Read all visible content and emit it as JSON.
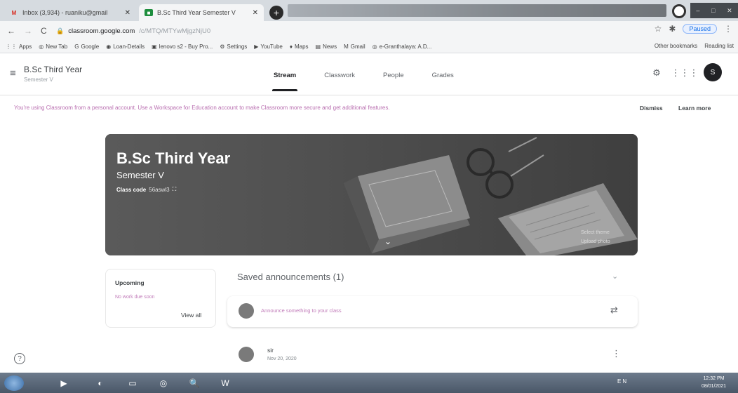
{
  "browser": {
    "tabs": [
      {
        "icon": "gmail-icon",
        "glyph": "M",
        "title": "Inbox (3,934) - ruaniku@gmail"
      },
      {
        "icon": "classroom-icon",
        "glyph": "■",
        "title": "B.Sc Third Year Semester V"
      }
    ],
    "new_tab": "+",
    "address": {
      "domain": "classroom.google.com",
      "path": "/c/MTQ/MTYwMjgzNjU0"
    },
    "profile_button": "Paused",
    "bookmarks": [
      {
        "icon": "apps-icon",
        "glyph": "⋮⋮",
        "label": "Apps"
      },
      {
        "icon": "chrome-icon",
        "glyph": "◎",
        "label": "New Tab"
      },
      {
        "icon": "google-icon",
        "glyph": "G",
        "label": "Google"
      },
      {
        "icon": "loan-icon",
        "glyph": "◉",
        "label": "Loan-Details"
      },
      {
        "icon": "lenovo-icon",
        "glyph": "▣",
        "label": "lenovo s2 - Buy Pro..."
      },
      {
        "icon": "settings-icon",
        "glyph": "⚙",
        "label": "Settings"
      },
      {
        "icon": "youtube-icon",
        "glyph": "▶",
        "label": "YouTube"
      },
      {
        "icon": "maps-icon",
        "glyph": "♦",
        "label": "Maps"
      },
      {
        "icon": "news-icon",
        "glyph": "▤",
        "label": "News"
      },
      {
        "icon": "gmail-icon",
        "glyph": "M",
        "label": "Gmail"
      },
      {
        "icon": "granthalaya-icon",
        "glyph": "◎",
        "label": "e-Granthalaya: A.D..."
      }
    ],
    "other_bookmarks": "Other bookmarks",
    "reading_list": "Reading list"
  },
  "header": {
    "class_name": "B.Sc Third Year",
    "section": "Semester V",
    "tabs": [
      "Stream",
      "Classwork",
      "People",
      "Grades"
    ],
    "active_tab": "Stream",
    "avatar_letter": "S"
  },
  "notice": {
    "text": "You're using Classroom from a personal account. Use a Workspace for Education account to make Classroom more secure and get additional features.",
    "dismiss": "Dismiss",
    "learn_more": "Learn more"
  },
  "banner": {
    "title": "B.Sc Third Year",
    "subtitle": "Semester V",
    "class_code_label": "Class code",
    "class_code_value": "56aswl3",
    "select_theme": "Select theme",
    "upload_photo": "Upload photo"
  },
  "upcoming": {
    "title": "Upcoming",
    "empty": "No work due soon",
    "view_all": "View all"
  },
  "saved": {
    "title": "Saved announcements (1)"
  },
  "compose": {
    "placeholder": "Announce something to your class"
  },
  "post": {
    "author": "sir",
    "date": "Nov 20, 2020"
  },
  "taskbar": {
    "tray": "EN",
    "time": "12:32 PM",
    "date": "08/01/2021"
  }
}
